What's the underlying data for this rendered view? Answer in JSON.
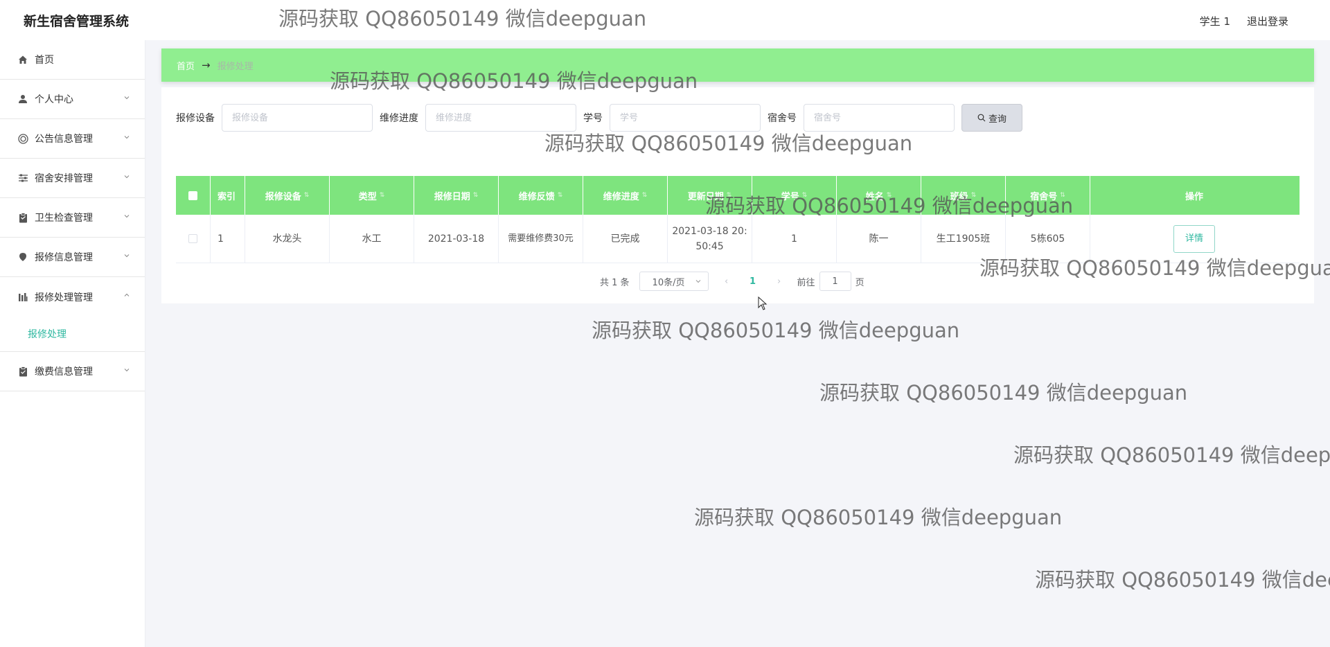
{
  "app": {
    "title": "新生宿舍管理系统"
  },
  "header": {
    "user": "学生 1",
    "logout": "退出登录"
  },
  "sidebar": {
    "items": [
      {
        "label": "首页",
        "icon": "home-icon"
      },
      {
        "label": "个人中心",
        "icon": "user-icon"
      },
      {
        "label": "公告信息管理",
        "icon": "notice-icon"
      },
      {
        "label": "宿舍安排管理",
        "icon": "sliders-icon"
      },
      {
        "label": "卫生检查管理",
        "icon": "clipboard-icon"
      },
      {
        "label": "报修信息管理",
        "icon": "pin-icon"
      },
      {
        "label": "报修处理管理",
        "icon": "chart-icon"
      },
      {
        "label": "缴费信息管理",
        "icon": "clipboard-check-icon"
      }
    ],
    "sub_active": "报修处理"
  },
  "breadcrumb": {
    "home": "首页",
    "arrow": "→",
    "current": "报修处理"
  },
  "search": {
    "device_label": "报修设备",
    "device_placeholder": "报修设备",
    "progress_label": "维修进度",
    "progress_placeholder": "维修进度",
    "sid_label": "学号",
    "sid_placeholder": "学号",
    "room_label": "宿舍号",
    "room_placeholder": "宿舍号",
    "query_button": "查询"
  },
  "table": {
    "headers": [
      "索引",
      "报修设备",
      "类型",
      "报修日期",
      "维修反馈",
      "维修进度",
      "更新日期",
      "学号",
      "姓名",
      "班级",
      "宿舍号",
      "操作"
    ],
    "rows": [
      {
        "index": "1",
        "device": "水龙头",
        "type": "水工",
        "date": "2021-03-18",
        "feedback": "需要维修费30元",
        "progress": "已完成",
        "updated": "2021-03-18 20:50:45",
        "sid": "1",
        "name": "陈一",
        "class": "生工1905班",
        "room": "5栋605",
        "action": "详情"
      }
    ]
  },
  "pagination": {
    "total": "共 1 条",
    "page_size": "10条/页",
    "current_page": "1",
    "goto_label": "前往",
    "goto_value": "1",
    "page_suffix": "页"
  },
  "watermark": "源码获取 QQ86050149 微信deepguan",
  "colors": {
    "accent_green": "#90ee90",
    "header_green": "#7ee47e",
    "teal": "#2fb8a0"
  }
}
